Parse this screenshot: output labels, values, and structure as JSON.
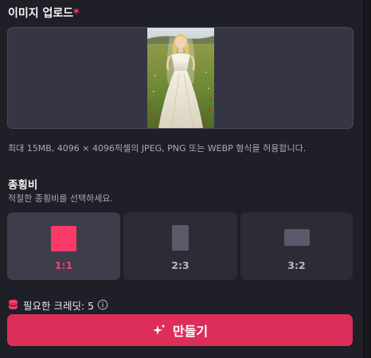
{
  "upload": {
    "title": "이미지 업로드",
    "required_mark": "*",
    "hint": "최대 15MB, 4096 × 4096픽셀의 JPEG, PNG 또는 WEBP 형식을 허용합니다."
  },
  "ratio": {
    "title": "종횡비",
    "subtitle": "적절한 종횡비를 선택하세요.",
    "options": [
      {
        "label": "1:1",
        "selected": true
      },
      {
        "label": "2:3",
        "selected": false
      },
      {
        "label": "3:2",
        "selected": false
      }
    ]
  },
  "credits": {
    "label": "필요한 크레딧: 5",
    "icon": "coin-stack-icon"
  },
  "generate": {
    "label": "만들기",
    "icon": "sparkle-icon"
  },
  "colors": {
    "accent": "#dd2e5a",
    "accent_text": "#ff3d6e",
    "background": "#1f1f27",
    "card": "#2c2c37",
    "card_active": "#3d3d4b"
  }
}
